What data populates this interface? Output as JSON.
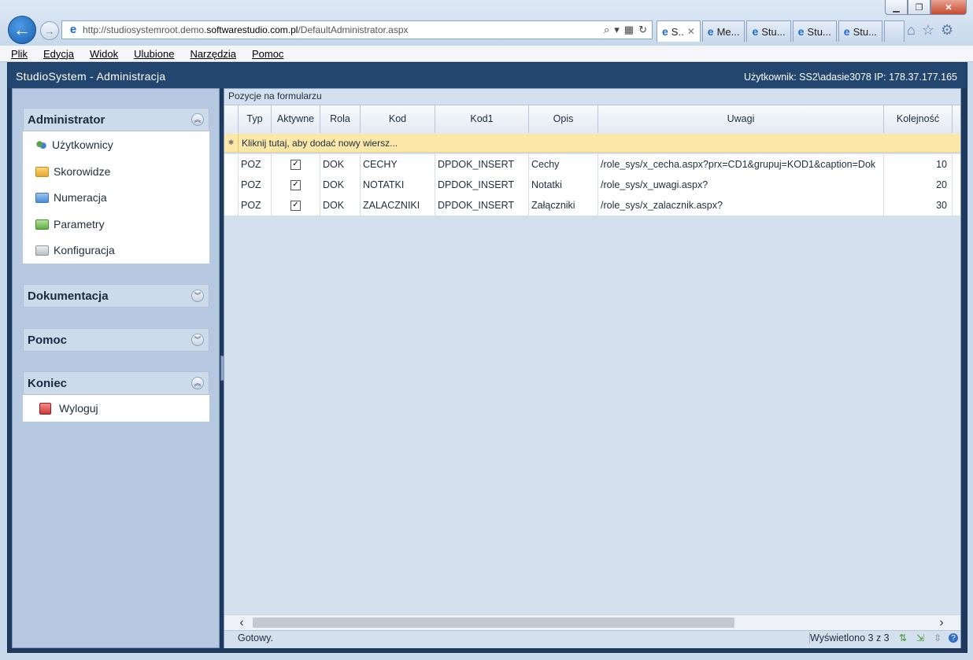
{
  "browser": {
    "url_prefix": "http://studiosystemroot.demo.",
    "url_domain": "softwarestudio.com.pl",
    "url_path": "/DefaultAdministrator.aspx",
    "tabs": [
      {
        "label": "S..",
        "active": true
      },
      {
        "label": "Me..."
      },
      {
        "label": "Stu..."
      },
      {
        "label": "Stu..."
      },
      {
        "label": "Stu..."
      }
    ]
  },
  "menu": [
    "Plik",
    "Edycja",
    "Widok",
    "Ulubione",
    "Narzędzia",
    "Pomoc"
  ],
  "app": {
    "title": "StudioSystem - Administracja",
    "user_info": "Użytkownik: SS2\\adasie3078 IP: 178.37.177.165"
  },
  "sidebar": {
    "administrator": {
      "title": "Administrator",
      "items": [
        "Użytkownicy",
        "Skorowidze",
        "Numeracja",
        "Parametry",
        "Konfiguracja"
      ]
    },
    "dokumentacja": {
      "title": "Dokumentacja"
    },
    "pomoc": {
      "title": "Pomoc"
    },
    "koniec": {
      "title": "Koniec",
      "items": [
        "Wyloguj"
      ]
    }
  },
  "grid": {
    "caption": "Pozycje na formularzu",
    "columns": [
      "Typ",
      "Aktywne",
      "Rola",
      "Kod",
      "Kod1",
      "Opis",
      "Uwagi",
      "Kolejność"
    ],
    "new_row_text": "Kliknij tutaj, aby dodać nowy wiersz...",
    "rows": [
      {
        "typ": "POZ",
        "aktywne": true,
        "rola": "DOK",
        "kod": "CECHY",
        "kod1": "DPDOK_INSERT",
        "opis": "Cechy",
        "uwagi": "/role_sys/x_cecha.aspx?prx=CD1&grupuj=KOD1&caption=Dok",
        "kolejnosc": "10"
      },
      {
        "typ": "POZ",
        "aktywne": true,
        "rola": "DOK",
        "kod": "NOTATKI",
        "kod1": "DPDOK_INSERT",
        "opis": "Notatki",
        "uwagi": "/role_sys/x_uwagi.aspx?",
        "kolejnosc": "20"
      },
      {
        "typ": "POZ",
        "aktywne": true,
        "rola": "DOK",
        "kod": "ZALACZNIKI",
        "kod1": "DPDOK_INSERT",
        "opis": "Załączniki",
        "uwagi": "/role_sys/x_zalacznik.aspx?",
        "kolejnosc": "30"
      }
    ]
  },
  "status": {
    "text": "Gotowy.",
    "count": "Wyświetlono 3 z 3"
  },
  "colors": {
    "header_bg": "#224670",
    "new_row_bg": "#fce9a9",
    "sidebar_bg": "#b6c9e0"
  }
}
